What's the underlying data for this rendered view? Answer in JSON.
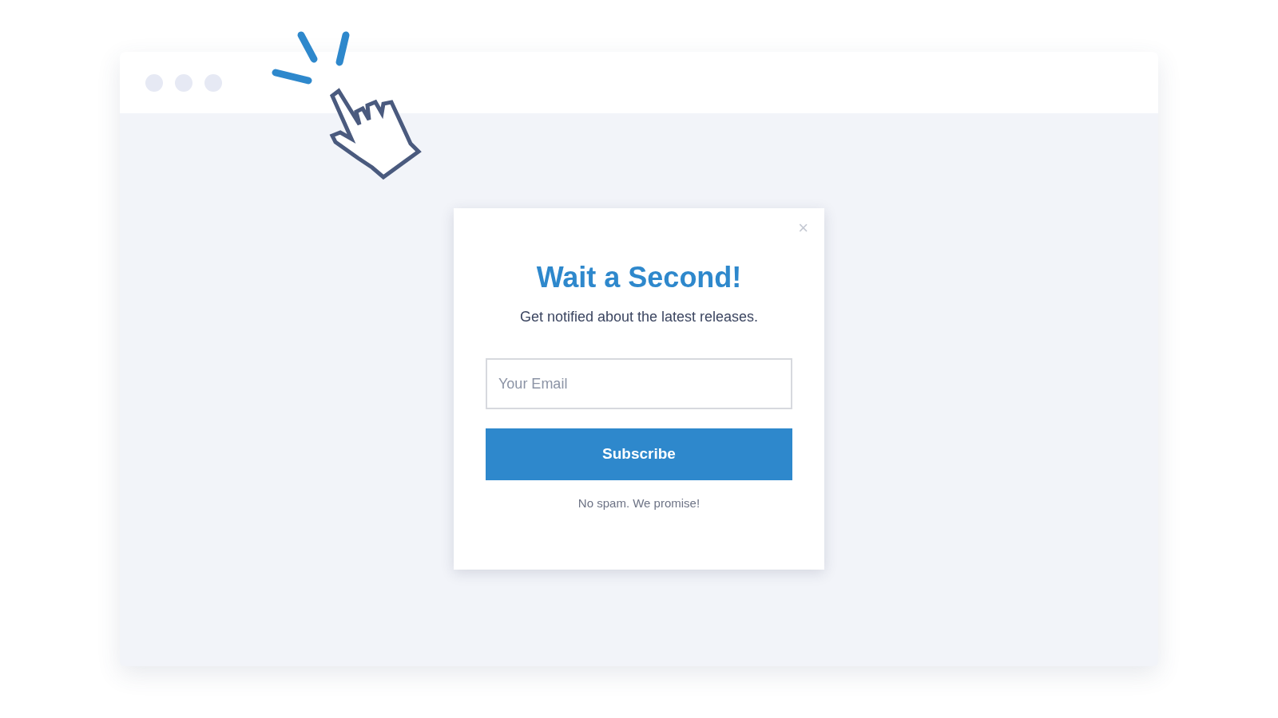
{
  "popup": {
    "close": "×",
    "title": "Wait a Second!",
    "subtitle": "Get notified about the latest releases.",
    "email_field": {
      "placeholder": "Your Email"
    },
    "button": "Subscribe",
    "note": "No spam. We promise!"
  }
}
